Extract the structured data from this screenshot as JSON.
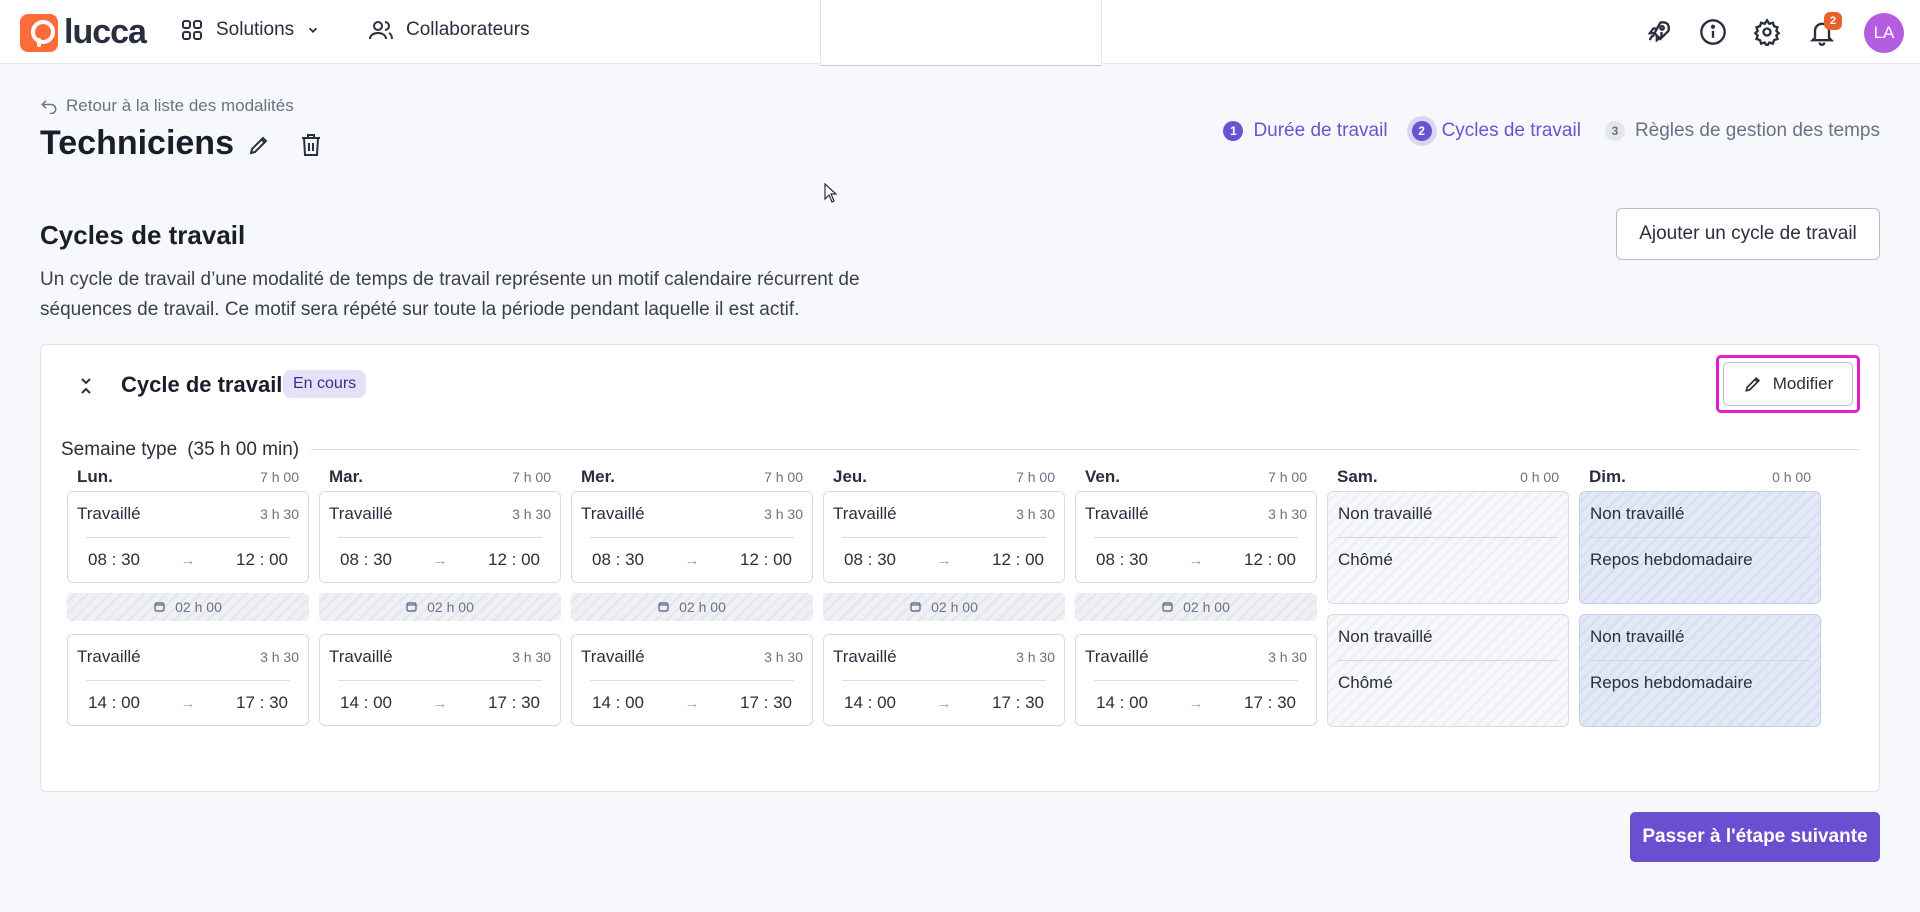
{
  "topbar": {
    "logo_text": "lucca",
    "nav": [
      {
        "label": "Solutions",
        "icon": "grid-icon"
      },
      {
        "label": "Collaborateurs",
        "icon": "users-icon"
      }
    ],
    "notifications_count": "2",
    "avatar_initials": "LA",
    "colors": {
      "brand": "#fc6c3b",
      "avatar": "#b55de0",
      "badge": "#e5622a"
    }
  },
  "header": {
    "back_label": "Retour à la liste des modalités",
    "title": "Techniciens",
    "steps": [
      {
        "num": "1",
        "label": "Durée de travail",
        "state": "done"
      },
      {
        "num": "2",
        "label": "Cycles de travail",
        "state": "current"
      },
      {
        "num": "3",
        "label": "Règles de gestion des temps",
        "state": "todo"
      }
    ]
  },
  "section": {
    "title": "Cycles de travail",
    "description": "Un cycle de travail d’une modalité de temps de travail représente un motif calendaire récurrent de séquences de travail. Ce motif sera répété sur toute la période pendant laquelle il est actif.",
    "add_button": "Ajouter un cycle de travail"
  },
  "cycle": {
    "title": "Cycle de travail",
    "badge": "En cours",
    "modify_button": "Modifier",
    "week_label": "Semaine type",
    "week_total": "(35 h 00 min)",
    "days": [
      {
        "name": "Lun.",
        "total": "7 h 00",
        "kind": "work",
        "slots": [
          {
            "type": "Travaillé",
            "dur": "3 h 30",
            "start": "08 : 30",
            "end": "12 : 00"
          },
          {
            "type": "Travaillé",
            "dur": "3 h 30",
            "start": "14 : 00",
            "end": "17 : 30"
          }
        ],
        "break": "02 h 00"
      },
      {
        "name": "Mar.",
        "total": "7 h 00",
        "kind": "work",
        "slots": [
          {
            "type": "Travaillé",
            "dur": "3 h 30",
            "start": "08 : 30",
            "end": "12 : 00"
          },
          {
            "type": "Travaillé",
            "dur": "3 h 30",
            "start": "14 : 00",
            "end": "17 : 30"
          }
        ],
        "break": "02 h 00"
      },
      {
        "name": "Mer.",
        "total": "7 h 00",
        "kind": "work",
        "slots": [
          {
            "type": "Travaillé",
            "dur": "3 h 30",
            "start": "08 : 30",
            "end": "12 : 00"
          },
          {
            "type": "Travaillé",
            "dur": "3 h 30",
            "start": "14 : 00",
            "end": "17 : 30"
          }
        ],
        "break": "02 h 00"
      },
      {
        "name": "Jeu.",
        "total": "7 h 00",
        "kind": "work",
        "slots": [
          {
            "type": "Travaillé",
            "dur": "3 h 30",
            "start": "08 : 30",
            "end": "12 : 00"
          },
          {
            "type": "Travaillé",
            "dur": "3 h 30",
            "start": "14 : 00",
            "end": "17 : 30"
          }
        ],
        "break": "02 h 00"
      },
      {
        "name": "Ven.",
        "total": "7 h 00",
        "kind": "work",
        "slots": [
          {
            "type": "Travaillé",
            "dur": "3 h 30",
            "start": "08 : 30",
            "end": "12 : 00"
          },
          {
            "type": "Travaillé",
            "dur": "3 h 30",
            "start": "14 : 00",
            "end": "17 : 30"
          }
        ],
        "break": "02 h 00"
      },
      {
        "name": "Sam.",
        "total": "0 h 00",
        "kind": "off",
        "offs": [
          {
            "head": "Non travaillé",
            "type": "Chômé"
          },
          {
            "head": "Non travaillé",
            "type": "Chômé"
          }
        ]
      },
      {
        "name": "Dim.",
        "total": "0 h 00",
        "kind": "repos",
        "offs": [
          {
            "head": "Non travaillé",
            "type": "Repos hebdomadaire"
          },
          {
            "head": "Non travaillé",
            "type": "Repos hebdomadaire"
          }
        ]
      }
    ]
  },
  "footer": {
    "next_button": "Passer à l'étape suivante",
    "accent": "#6b4fd1"
  }
}
